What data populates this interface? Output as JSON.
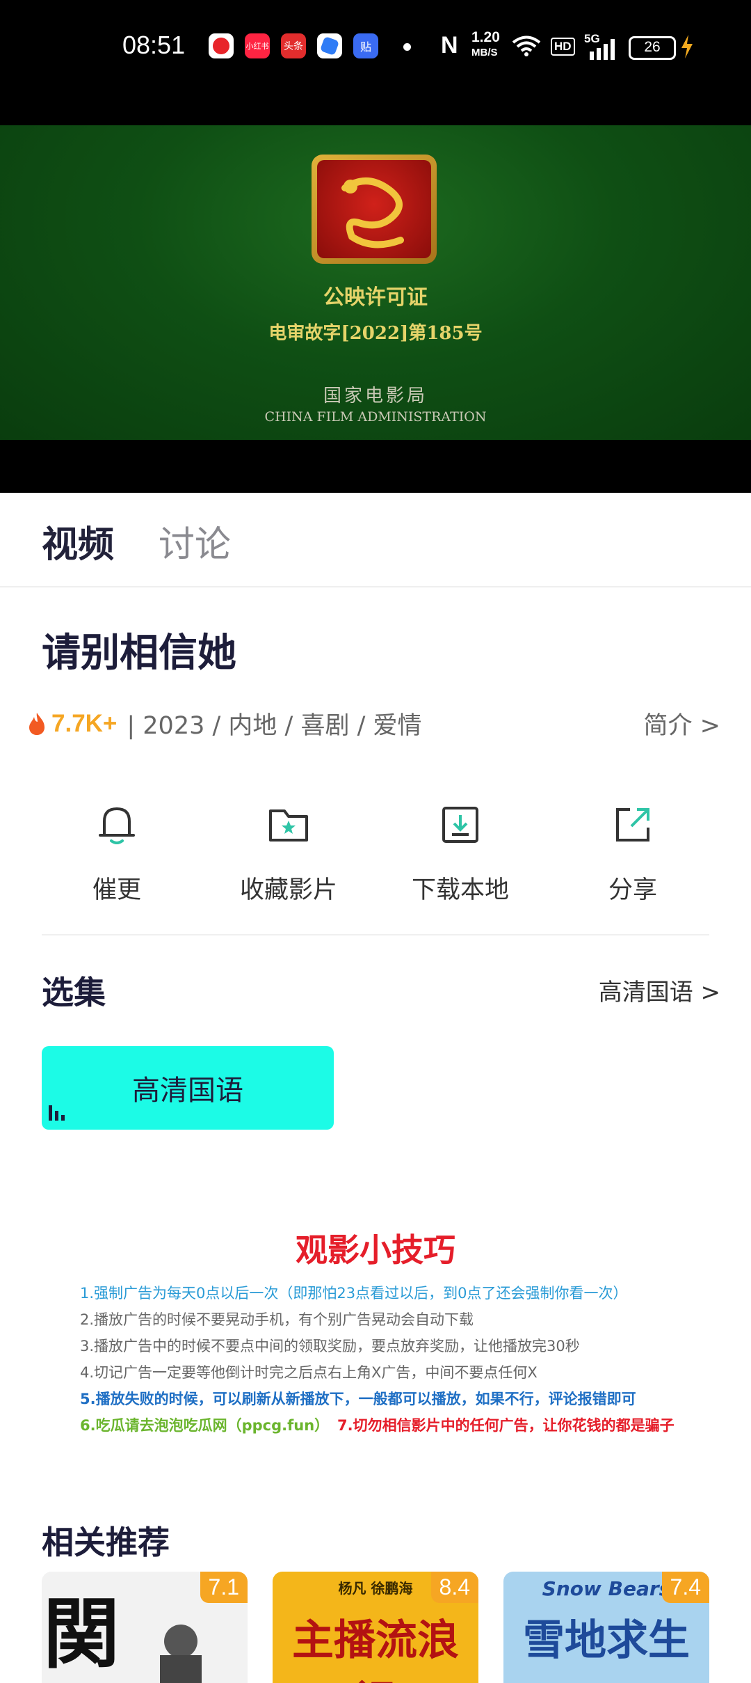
{
  "status_bar": {
    "time": "08:51",
    "apps": [
      {
        "name": "video-app",
        "label": "",
        "color": "#e8242a"
      },
      {
        "name": "xiaohongshu",
        "label": "小红书",
        "color": "#ff2442"
      },
      {
        "name": "toutiao",
        "label": "头条",
        "color": "#e22d2d"
      },
      {
        "name": "blue-app",
        "label": "",
        "color": "#2f7cf6"
      },
      {
        "name": "tieba",
        "label": "贴",
        "color": "#3a6bf2"
      }
    ],
    "net_speed": "1.20",
    "net_unit": "MB/S",
    "hd": "HD",
    "signal": "5G",
    "battery": "26"
  },
  "player": {
    "license_title": "公映许可证",
    "license_number": "电审故字[2022]第185号",
    "org": "国家电影局",
    "org_en": "CHINA FILM ADMINISTRATION"
  },
  "tabs": [
    "视频",
    "讨论"
  ],
  "movie": {
    "title": "请别相信她",
    "heat": "7.7K+",
    "meta": "| 2023 / 内地 / 喜剧 / 爱情",
    "intro_link": "简介 >"
  },
  "actions": [
    {
      "label": "催更",
      "icon": "bell-icon"
    },
    {
      "label": "收藏影片",
      "icon": "folder-star-icon"
    },
    {
      "label": "下载本地",
      "icon": "download-icon"
    },
    {
      "label": "分享",
      "icon": "share-icon"
    }
  ],
  "episodes": {
    "title": "选集",
    "source_link": "高清国语 >",
    "items": [
      "高清国语"
    ]
  },
  "tips": {
    "title": "观影小技巧",
    "lines": [
      {
        "text": "1.强制广告为每天0点以后一次（即那怕23点看过以后，到0点了还会强制你看一次）",
        "color": "#2a9bd6"
      },
      {
        "text": "2.播放广告的时候不要晃动手机，有个别广告晃动会自动下载",
        "color": "#666666"
      },
      {
        "text": "3.播放广告中的时候不要点中间的领取奖励，要点放弃奖励，让他播放完30秒",
        "color": "#666666"
      },
      {
        "text": "4.切记广告一定要等他倒计时完之后点右上角X广告，中间不要点任何X",
        "color": "#666666"
      },
      {
        "text": "5.播放失败的时候，可以刷新从新播放下，一般都可以播放，如果不行，评论报错即可",
        "color": "#1f6fc4"
      },
      {
        "text": "6.吃瓜请去泡泡吃瓜网（ppcg.fun）",
        "color": "#6bb52e"
      },
      {
        "text": "7.切勿相信影片中的任何广告，让你花钱的都是骗子",
        "color": "#e51e2a"
      }
    ]
  },
  "recommend": {
    "title": "相关推荐",
    "items": [
      {
        "score": "7.1",
        "poster_text": "関",
        "bg": "#f2f2f2",
        "fg": "#111111"
      },
      {
        "score": "8.4",
        "poster_text": "主播流浪记",
        "credits": "杨凡 徐鹏海",
        "bg": "#f4b61a",
        "fg": "#b31212"
      },
      {
        "score": "7.4",
        "poster_text": "雪地求生",
        "sub": "Snow Bears",
        "bg": "#a9d3ef",
        "fg": "#1e4a9a"
      }
    ]
  }
}
